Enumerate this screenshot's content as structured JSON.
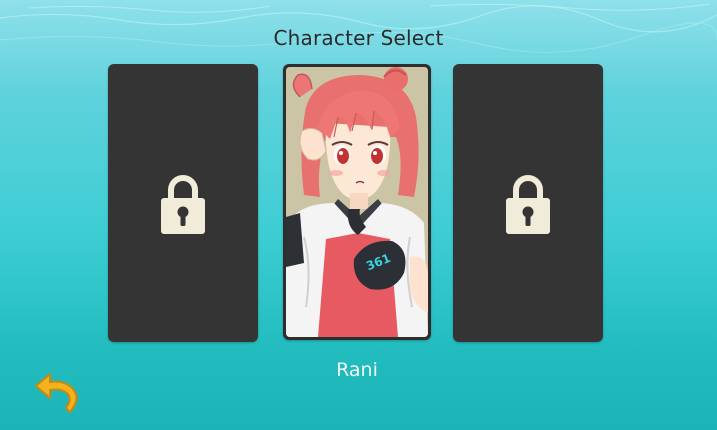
{
  "screen": {
    "title": "Character Select",
    "background_color": "#3ccdd3"
  },
  "character_slots": [
    {
      "status": "locked",
      "icon": "lock-icon"
    },
    {
      "status": "selected",
      "name": "Rani",
      "portrait": "anime-girl-red-hair-portrait",
      "badge_text": "361"
    },
    {
      "status": "locked",
      "icon": "lock-icon"
    }
  ],
  "back_button": {
    "icon": "back-arrow-icon",
    "color": "#f4b21e"
  }
}
